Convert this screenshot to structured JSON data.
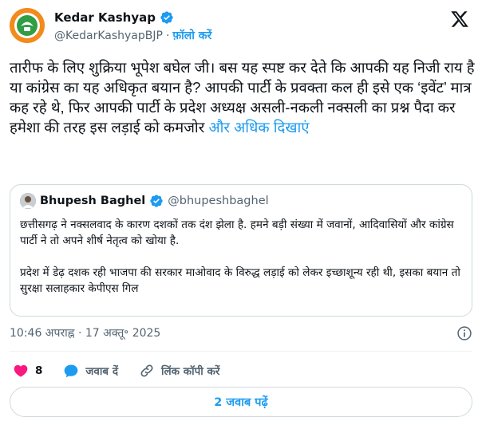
{
  "author": {
    "name": "Kedar Kashyap",
    "handle": "@KedarKashyapBJP",
    "separator": "·",
    "follow_label": "फ़ॉलो करें"
  },
  "tweet": {
    "text": "तारीफ के लिए शुक्रिया भूपेश बघेल जी। बस यह स्पष्ट कर देते कि आपकी यह निजी राय है या कांग्रेस का यह अधिकृत बयान है? आपकी पार्टी के प्रवक्ता कल ही इसे एक ‘इवेंट’ मात्र कह रहे थे, फिर आपकी पार्टी के प्रदेश अध्यक्ष असली-नकली नक्सली का प्रश्न पैदा कर हमेशा की तरह इस लड़ाई को कमजोर",
    "show_more": "और अधिक दिखाएं"
  },
  "quote": {
    "name": "Bhupesh Baghel",
    "handle": "@bhupeshbaghel",
    "para1": "छत्तीसगढ़ ने नक्सलवाद के कारण दशकों तक दंश झेला है. हमने बड़ी संख्या में जवानों, आदिवासियों और कांग्रेस पार्टी ने तो अपने शीर्ष नेतृत्व को खोया है.",
    "para2": "प्रदेश में डेढ़ दशक रही भाजपा की सरकार माओवाद के विरुद्ध लड़ाई को लेकर इच्छाशून्य रही थी, इसका बयान तो सुरक्षा सलाहकार केपीएस गिल"
  },
  "timestamp": "10:46 अपराह्न · 17 अक्तू॰ 2025",
  "actions": {
    "like_count": "8",
    "reply_label": "जवाब दें",
    "copy_link_label": "लिंक कॉपी करें"
  },
  "read_replies_label": "2 जवाब पढ़ें",
  "colors": {
    "accent": "#1d9bf0",
    "like": "#f91880",
    "text": "#0f1419",
    "muted": "#536471",
    "border": "#cfd9de"
  },
  "icons": {
    "verified": "verified-badge-icon",
    "x_logo": "x-logo-icon",
    "info": "info-icon",
    "like": "heart-icon",
    "reply": "speech-bubble-icon",
    "copy_link": "link-icon"
  }
}
